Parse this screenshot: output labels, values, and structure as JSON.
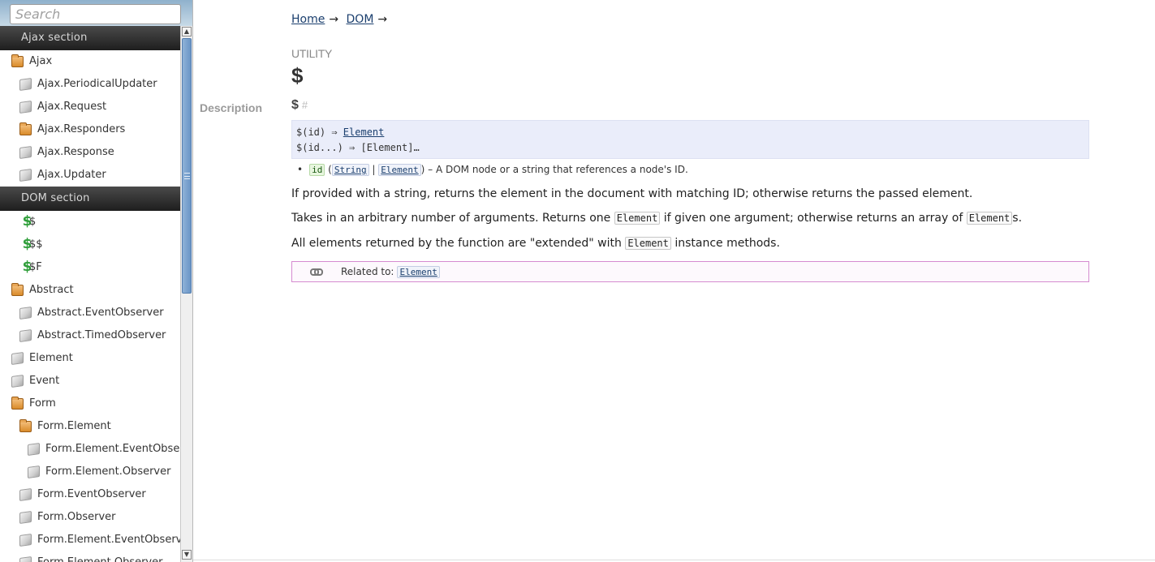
{
  "search": {
    "placeholder": "Search"
  },
  "sidebar": {
    "sections": [
      {
        "title": "Ajax section",
        "items": [
          {
            "label": "Ajax",
            "icon": "folder-icon",
            "indent": 0
          },
          {
            "label": "Ajax.PeriodicalUpdater",
            "icon": "cube-icon",
            "indent": 1
          },
          {
            "label": "Ajax.Request",
            "icon": "cube-icon",
            "indent": 1
          },
          {
            "label": "Ajax.Responders",
            "icon": "folder-icon",
            "indent": 1
          },
          {
            "label": "Ajax.Response",
            "icon": "cube-icon",
            "indent": 1
          },
          {
            "label": "Ajax.Updater",
            "icon": "cube-icon",
            "indent": 1
          }
        ]
      },
      {
        "title": "DOM section",
        "items": [
          {
            "label": "$",
            "icon": "dollar-icon",
            "indent": 1
          },
          {
            "label": "$$",
            "icon": "dollar-icon",
            "indent": 1
          },
          {
            "label": "$F",
            "icon": "dollar-icon",
            "indent": 1
          },
          {
            "label": "Abstract",
            "icon": "folder-icon",
            "indent": 0
          },
          {
            "label": "Abstract.EventObserver",
            "icon": "cube-icon",
            "indent": 1
          },
          {
            "label": "Abstract.TimedObserver",
            "icon": "cube-icon",
            "indent": 1
          },
          {
            "label": "Element",
            "icon": "cube-icon",
            "indent": 0
          },
          {
            "label": "Event",
            "icon": "cube-icon",
            "indent": 0
          },
          {
            "label": "Form",
            "icon": "folder-icon",
            "indent": 0
          },
          {
            "label": "Form.Element",
            "icon": "folder-icon",
            "indent": 1
          },
          {
            "label": "Form.Element.EventObserver",
            "icon": "cube-icon",
            "indent": 2
          },
          {
            "label": "Form.Element.Observer",
            "icon": "cube-icon",
            "indent": 2
          },
          {
            "label": "Form.EventObserver",
            "icon": "cube-icon",
            "indent": 1
          },
          {
            "label": "Form.Observer",
            "icon": "cube-icon",
            "indent": 1
          },
          {
            "label": "Form.Element.EventObserver",
            "icon": "cube-icon",
            "indent": 1
          },
          {
            "label": "Form.Element.Observer",
            "icon": "cube-icon",
            "indent": 1
          }
        ]
      }
    ]
  },
  "breadcrumb": {
    "home": "Home",
    "dom": "DOM",
    "arrow": "→"
  },
  "page": {
    "category": "UTILITY",
    "title": "$",
    "description_label": "Description",
    "method_name": "$",
    "method_hash": "#"
  },
  "signature": {
    "line1_prefix": "$(id) ⇒ ",
    "line1_link": "Element",
    "line2": "$(id...) ⇒ [Element]…"
  },
  "params": {
    "name": "id",
    "open": "(",
    "type1": "String",
    "separator": "|",
    "type2": "Element",
    "close": ")",
    "description": " – A DOM node or a string that references a node's ID."
  },
  "paragraphs": {
    "p1": "If provided with a string, returns the element in the document with matching ID; otherwise returns the passed element.",
    "p2_a": "Takes in an arbitrary number of arguments. Returns one ",
    "p2_code1": "Element",
    "p2_b": " if given one argument; otherwise returns an array of ",
    "p2_code2": "Element",
    "p2_c": "s.",
    "p3_a": "All elements returned by the function are \"extended\" with ",
    "p3_code": "Element",
    "p3_b": " instance methods."
  },
  "related": {
    "label": "Related to:",
    "link": "Element"
  },
  "colors": {
    "section_header_bg": "#1e1e1e",
    "link": "#1b3f6e",
    "signature_bg": "#eaedfa",
    "related_border": "#d58bd0",
    "dollar_icon": "#2f9e3a",
    "scroll_thumb": "#6a95c5"
  }
}
